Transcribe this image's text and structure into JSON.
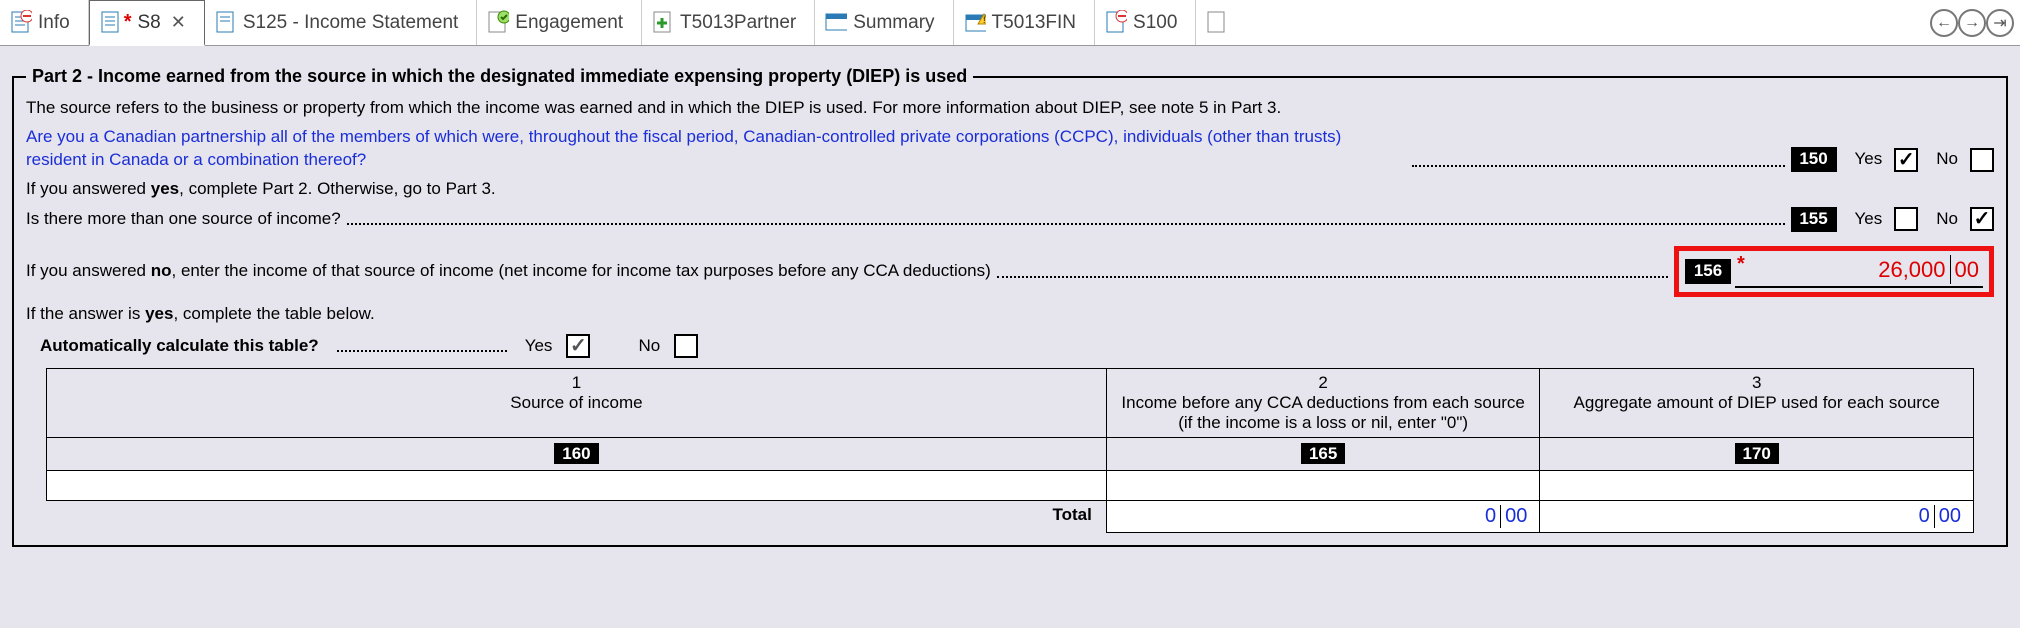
{
  "tabs": [
    {
      "label": "Info"
    },
    {
      "label": "S8",
      "active": true,
      "modified": true
    },
    {
      "label": "S125 - Income Statement"
    },
    {
      "label": "Engagement"
    },
    {
      "label": "T5013Partner"
    },
    {
      "label": "Summary"
    },
    {
      "label": "T5013FIN"
    },
    {
      "label": "S100"
    }
  ],
  "part2": {
    "legend": "Part 2 - Income earned from the source in which the designated immediate expensing property (DIEP) is used",
    "intro": "The source refers to the business or property from which the income was earned and in which the DIEP is used. For more information about DIEP, see note 5 in Part 3.",
    "q_ccpc": "Are you a Canadian partnership all of the members of which were, throughout the fiscal period, Canadian-controlled private corporations (CCPC), individuals (other than trusts) resident in Canada or a combination thereof?",
    "q_ccpc_code": "150",
    "q_ccpc_yes": true,
    "q_ccpc_hint": "If you answered yes, complete Part 2. Otherwise, go to Part 3.",
    "q_multi": "Is there more than one source of income?",
    "q_multi_code": "155",
    "q_multi_no": true,
    "q_no_income_line": "If you answered no, enter the income of that source of income (net income for income tax purposes before any CCA deductions)",
    "q_no_income_code": "156",
    "amount_dollars": "26,000",
    "amount_cents": "00",
    "q_yes_hint": "If the answer is yes, complete the table below.",
    "autocalc_label": "Automatically calculate this table?",
    "autocalc_yes": true,
    "yes": "Yes",
    "no": "No",
    "table": {
      "col1_num": "1",
      "col1_head": "Source of income",
      "col1_code": "160",
      "col2_num": "2",
      "col2_head": "Income before any CCA deductions from each source (if the income is a loss or nil, enter \"0\")",
      "col2_code": "165",
      "col3_num": "3",
      "col3_head": "Aggregate amount of DIEP used for each source",
      "col3_code": "170",
      "total_label": "Total",
      "total2_d": "0",
      "total2_c": "00",
      "total3_d": "0",
      "total3_c": "00"
    }
  }
}
